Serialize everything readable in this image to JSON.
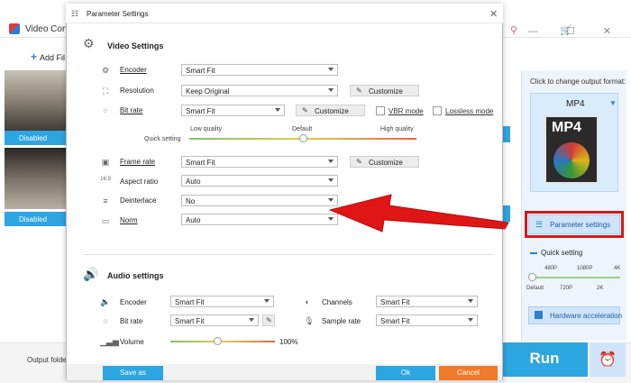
{
  "app": {
    "title": "Video Con",
    "add_files": "Add Fil",
    "win_controls": "— ☐ ✕",
    "top_icons": "⚲ 🛒",
    "disabled_1": "Disabled",
    "disabled_2": "Disabled",
    "output_folder": "Output folde",
    "run": "Run"
  },
  "output_panel": {
    "hint": "Click to change output format:",
    "format": "MP4",
    "format_icon_text": "MP4",
    "parameter_settings": "Parameter settings",
    "quick_setting": "Quick setting",
    "quick_top": [
      "480P",
      "1080P",
      "4K"
    ],
    "quick_bottom": [
      "Default",
      "720P",
      "2K"
    ],
    "hardware_acceleration": "Hardware acceleration"
  },
  "dialog": {
    "title": "Parameter Settings",
    "video_section": "Video Settings",
    "audio_section": "Audio settings",
    "video": {
      "encoder_label": "Encoder",
      "encoder_value": "Smart Fit",
      "resolution_label": "Resolution",
      "resolution_value": "Keep Original",
      "bitrate_label": "Bit rate",
      "bitrate_value": "Smart Fit",
      "vbr_label": "VBR mode",
      "lossless_label": "Lossless mode",
      "quick_setting_label": "Quick setting",
      "low_quality": "Low quality",
      "default": "Default",
      "high_quality": "High quality",
      "framerate_label": "Frame rate",
      "framerate_value": "Smart Fit",
      "aspect_label": "Aspect ratio",
      "aspect_value": "Auto",
      "deinterlace_label": "Deinterlace",
      "deinterlace_value": "No",
      "norm_label": "Norm",
      "norm_value": "Auto",
      "customize": "Customize"
    },
    "audio": {
      "encoder_label": "Encoder",
      "encoder_value": "Smart Fit",
      "channels_label": "Channels",
      "channels_value": "Smart Fit",
      "bitrate_label": "Bit rate",
      "bitrate_value": "Smart Fit",
      "samplerate_label": "Sample rate",
      "samplerate_value": "Smart Fit",
      "volume_label": "Volume",
      "volume_value": "100%"
    },
    "quality_slider_position": 0.5,
    "volume_slider_position": 0.45,
    "save_as": "Save as",
    "ok": "Ok",
    "cancel": "Cancel"
  },
  "colors": {
    "accent": "#2da5e0",
    "cancel": "#f07a2a",
    "annotation": "#d11a1a"
  }
}
